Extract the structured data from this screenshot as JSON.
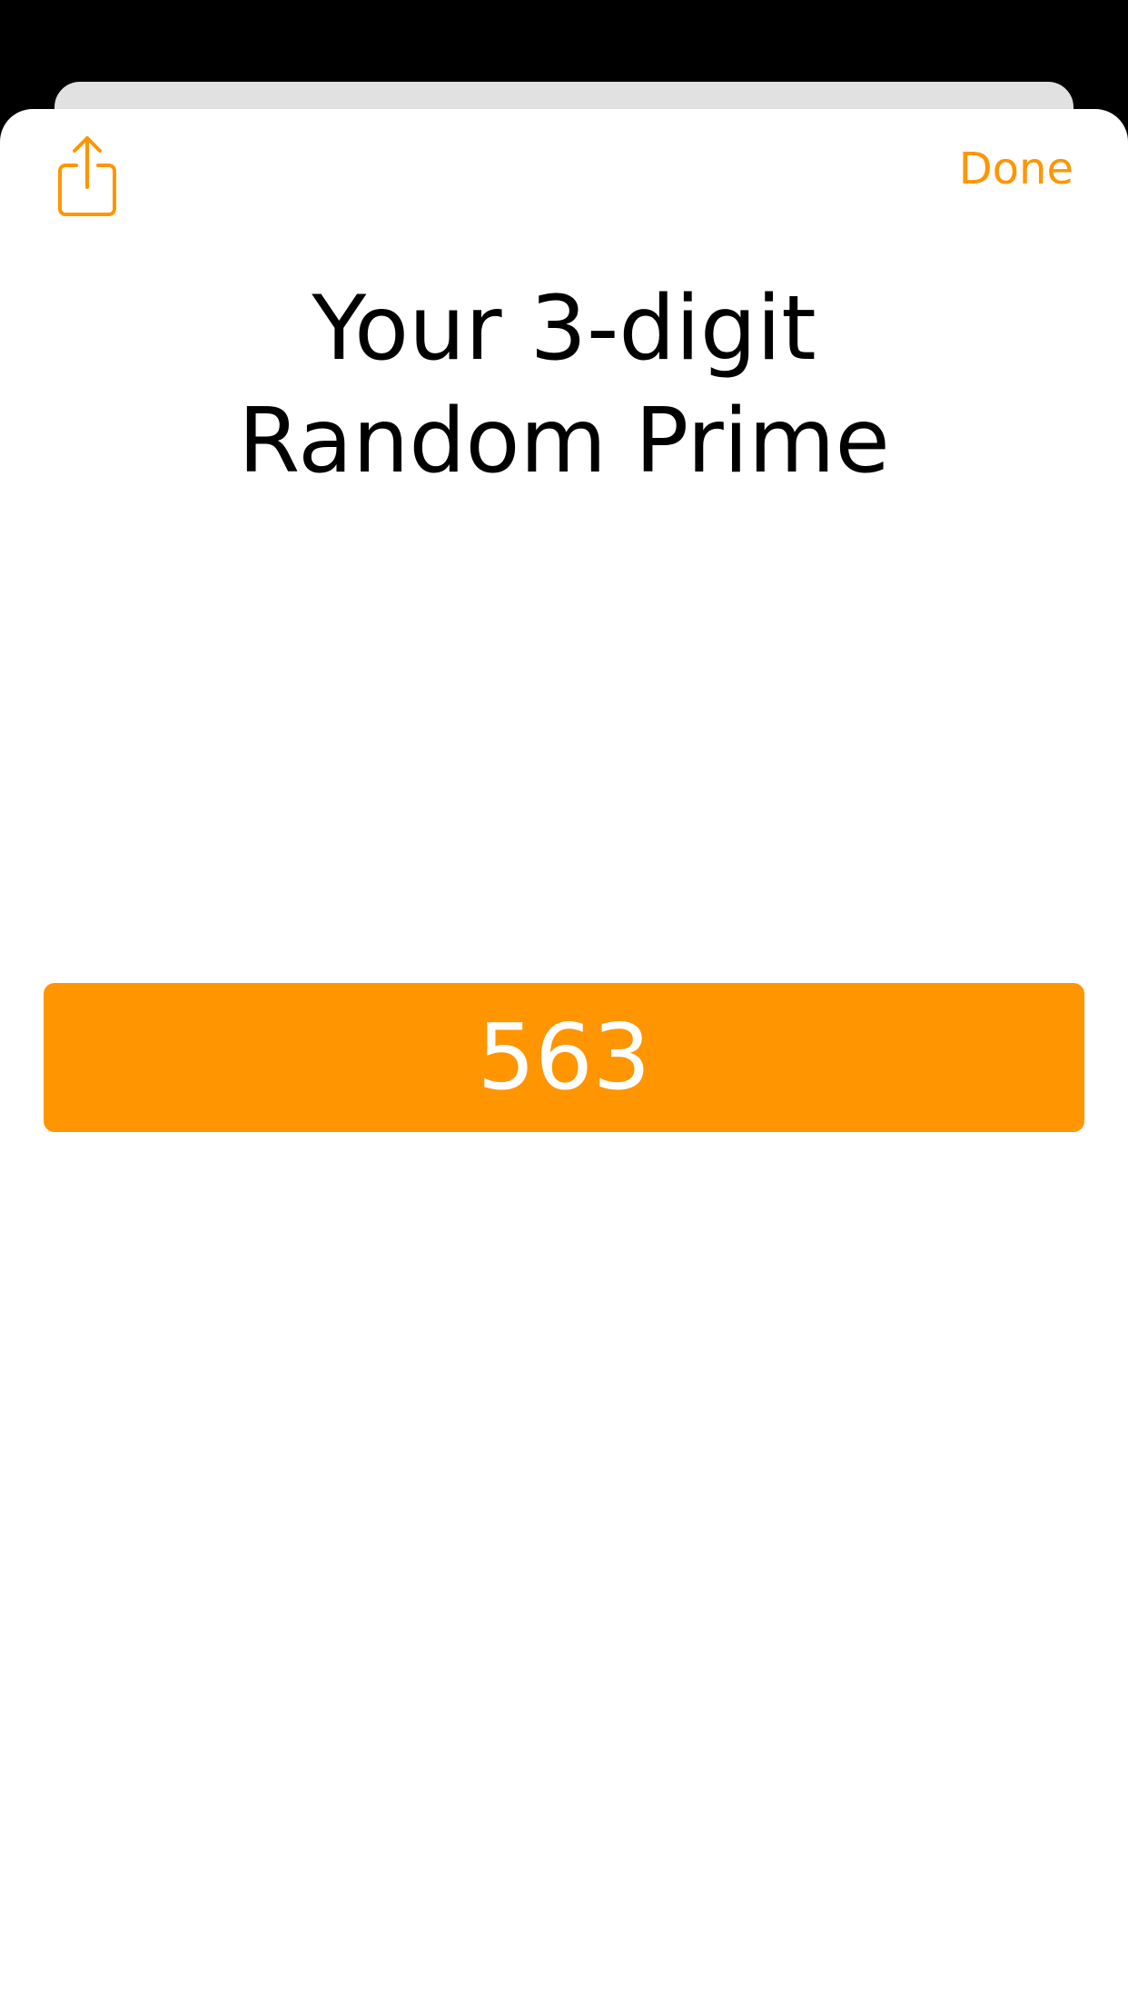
{
  "colors": {
    "accent": "#ff9500",
    "background": "#ffffff"
  },
  "header": {
    "share_icon": "share-icon",
    "done_label": "Done"
  },
  "title": {
    "line1": "Your 3-digit",
    "line2": "Random Prime"
  },
  "result": {
    "value": "563"
  }
}
